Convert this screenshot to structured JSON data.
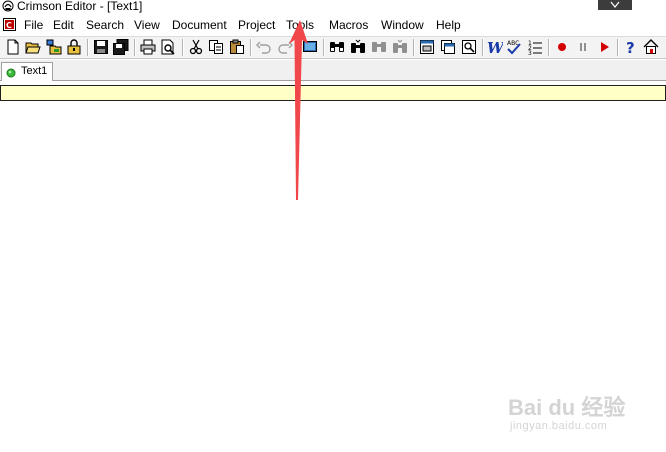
{
  "window": {
    "title": "Crimson Editor - [Text1]"
  },
  "menu": [
    "File",
    "Edit",
    "Search",
    "View",
    "Document",
    "Project",
    "Tools",
    "Macros",
    "Window",
    "Help"
  ],
  "toolbar": {
    "icons": [
      "new-file-icon",
      "open-file-icon",
      "open-remote-icon",
      "open-folder-icon",
      "save-icon",
      "save-all-icon",
      "print-icon",
      "print-preview-icon",
      "cut-icon",
      "copy-icon",
      "paste-icon",
      "undo-icon",
      "redo-icon",
      "screen-icon",
      "find-icon",
      "find-next-icon",
      "replace-icon",
      "replace-next-icon",
      "view-window-icon",
      "view-multi-icon",
      "view-zoom-icon",
      "word-wrap-icon",
      "spell-check-icon",
      "line-numbers-icon",
      "record-macro-icon",
      "pause-macro-icon",
      "play-macro-icon",
      "help-icon",
      "home-icon"
    ]
  },
  "tabs": [
    {
      "label": "Text1"
    }
  ],
  "colors": {
    "current_line": "#ffffc6",
    "arrow": "#f0474a",
    "record": "#d40000"
  },
  "watermark": {
    "text": "Bai du 经验",
    "sub": "jingyan.baidu.com"
  }
}
